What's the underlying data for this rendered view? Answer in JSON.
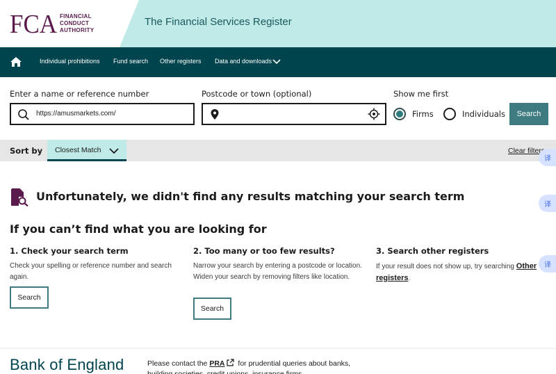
{
  "header": {
    "logo_text": "FCA",
    "logo_words": [
      "FINANCIAL",
      "CONDUCT",
      "AUTHORITY"
    ],
    "title": "The Financial Services Register"
  },
  "nav": {
    "items": [
      "Individual prohibitions",
      "Fund search",
      "Other registers",
      "Data and downloads"
    ]
  },
  "search": {
    "name_label": "Enter a name or reference number",
    "name_value": "https://amusmarkets.com/",
    "postcode_label": "Postcode or town (optional)",
    "postcode_value": "",
    "show_first_label": "Show me first",
    "options": [
      "Firms",
      "Individuals"
    ],
    "selected": "Firms",
    "button": "Search"
  },
  "sort": {
    "label": "Sort by",
    "value": "Closest Match",
    "clear": "Clear filters"
  },
  "side_widgets": [
    "译",
    "译",
    "译"
  ],
  "results": {
    "no_results": "Unfortunately, we didn't find any results matching your search term",
    "help_title": "If you can’t find what you are looking for",
    "columns": [
      {
        "heading": "1. Check your search term",
        "text": "Check your spelling or reference number and search again.",
        "button": "Search"
      },
      {
        "heading": "2. Too many or too few results?",
        "text": "Narrow your search by entering a postcode or location. Widen your search by removing filters like location.",
        "button": "Search"
      },
      {
        "heading": "3. Search other registers",
        "text_before": "If your result does not show up, try searching ",
        "link": "Other registers",
        "text_after": "."
      }
    ]
  },
  "footer": {
    "brand": "Bank of England",
    "text_before": "Please contact the ",
    "link": "PRA",
    "text_after": " for prudential queries about banks, building societies, credit unions, insurance firms"
  },
  "colors": {
    "nav_bg": "#00444d",
    "header_accent": "#bfeae8",
    "brand_purple": "#5a1b4c",
    "button_teal": "#3d7b80"
  }
}
